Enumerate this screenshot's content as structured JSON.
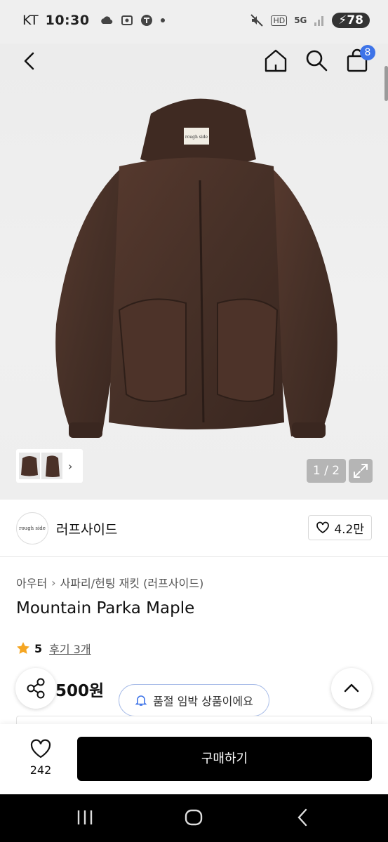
{
  "status_bar": {
    "carrier": "KT",
    "time": "10:30",
    "network": "5G",
    "hd": "HD",
    "battery": "78"
  },
  "header": {
    "cart_count": "8"
  },
  "gallery": {
    "pager": "1 / 2",
    "tag_text": "rough side"
  },
  "brand": {
    "logo_text": "rough side",
    "name": "러프사이드",
    "likes": "4.2만"
  },
  "product": {
    "breadcrumb": [
      "아우터",
      "사파리/헌팅 재킷 (러프사이드)"
    ],
    "title": "Mountain Parka Maple",
    "rating": "5",
    "review_label": "후기 3개",
    "price": "500원",
    "soldout_notice": "품절 임박 상품이에요"
  },
  "bottom_bar": {
    "wish_count": "242",
    "buy_label": "구매하기"
  },
  "colors": {
    "accent_blue": "#3d73e8",
    "star": "#f5a623",
    "jacket_brown": "#4a3128",
    "buy_button": "#000000"
  }
}
